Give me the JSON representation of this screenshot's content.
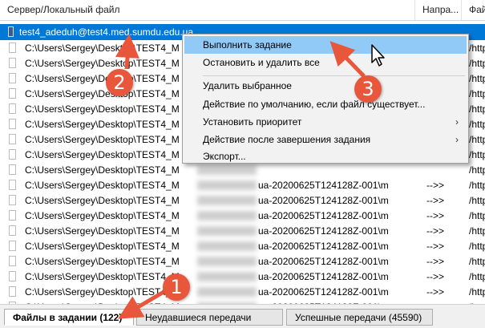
{
  "columns": {
    "server": "Сервер/Локальный файл",
    "direction": "Напра...",
    "file": "Фай"
  },
  "server_row": {
    "text": "test4_adeduh@test4.med.sumdu.edu.ua"
  },
  "rows": [
    {
      "path": "C:\\Users\\Sergey\\Desktop\\TEST4_MED",
      "remote": "",
      "dir": "",
      "url": "/http"
    },
    {
      "path": "C:\\Users\\Sergey\\Desktop\\TEST4_MED",
      "remote": "",
      "dir": "",
      "url": "/http"
    },
    {
      "path": "C:\\Users\\Sergey\\Desktop\\TEST4_MED",
      "remote": "",
      "dir": "",
      "url": "/http"
    },
    {
      "path": "C:\\Users\\Sergey\\Desktop\\TEST4_MED",
      "remote": "",
      "dir": "",
      "url": "/http"
    },
    {
      "path": "C:\\Users\\Sergey\\Desktop\\TEST4_MED",
      "remote": "",
      "dir": "",
      "url": "/http"
    },
    {
      "path": "C:\\Users\\Sergey\\Desktop\\TEST4_MED",
      "remote": "",
      "dir": "",
      "url": "/http"
    },
    {
      "path": "C:\\Users\\Sergey\\Desktop\\TEST4_MED",
      "remote": "",
      "dir": "",
      "url": "/http"
    },
    {
      "path": "C:\\Users\\Sergey\\Desktop\\TEST4_MED",
      "remote": "",
      "dir": "",
      "url": "/http"
    },
    {
      "path": "C:\\Users\\Sergey\\Desktop\\TEST4_MED",
      "remote": "",
      "dir": "",
      "url": "/http"
    },
    {
      "path": "C:\\Users\\Sergey\\Desktop\\TEST4_MED\\med.sumdu.edu",
      "remote": "ua-20200625T124128Z-001\\m",
      "dir": "-->>",
      "url": "/http"
    },
    {
      "path": "C:\\Users\\Sergey\\Desktop\\TEST4_MED\\m",
      "remote": "ua-20200625T124128Z-001\\m",
      "dir": "-->>",
      "url": "/http"
    },
    {
      "path": "C:\\Users\\Sergey\\Desktop\\TEST4_MED\\m",
      "remote": "ua-20200625T124128Z-001\\m",
      "dir": "-->>",
      "url": "/http"
    },
    {
      "path": "C:\\Users\\Sergey\\Desktop\\TEST4_MED\\m",
      "remote": "ua-20200625T124128Z-001\\m",
      "dir": "-->>",
      "url": "/http"
    },
    {
      "path": "C:\\Users\\Sergey\\Desktop\\TEST4_MED\\m",
      "remote": "ua-20200625T124128Z-001\\m",
      "dir": "-->>",
      "url": "/http"
    },
    {
      "path": "C:\\Users\\Sergey\\Desktop\\TEST4_MED\\m",
      "remote": "ua-20200625T124128Z-001\\m",
      "dir": "-->>",
      "url": "/http"
    },
    {
      "path": "C:\\Users\\Sergey\\Desktop\\TEST4_MED\\m",
      "remote": "ua-20200625T124128Z-001\\m",
      "dir": "-->>",
      "url": "/http"
    },
    {
      "path": "C:\\Users\\Sergey\\Desktop\\TEST4_MED\\m",
      "remote": "ua-20200625T124128Z-001\\m",
      "dir": "-->>",
      "url": "/http"
    },
    {
      "path": "C:\\Users\\Sergey\\Desktop\\TEST4_MED\\m",
      "remote": "ua-20200625T124128Z-001\\m",
      "dir": "-->>",
      "url": "/http"
    }
  ],
  "context_menu": {
    "items": [
      {
        "label": "Выполнить задание",
        "submenu": false
      },
      {
        "label": "Остановить и удалить все",
        "submenu": false
      },
      {
        "label": "Удалить выбранное",
        "submenu": false
      },
      {
        "label": "Действие по умолчанию, если файл существует...",
        "submenu": false
      },
      {
        "label": "Установить приоритет",
        "submenu": true
      },
      {
        "label": "Действие после завершения задания",
        "submenu": true
      },
      {
        "label": "Экспорт...",
        "submenu": false
      }
    ],
    "submenu_glyph": "›"
  },
  "tabs": [
    {
      "label": "Файлы в задании (122)",
      "active": true
    },
    {
      "label": "Неудавшиеся передачи",
      "active": false
    },
    {
      "label": "Успешные передачи (45590)",
      "active": false
    }
  ],
  "callouts": [
    "1",
    "2",
    "3"
  ],
  "colors": {
    "selection": "#0078d7",
    "menu_highlight": "#91c9f7",
    "callout": "#e8563c"
  }
}
